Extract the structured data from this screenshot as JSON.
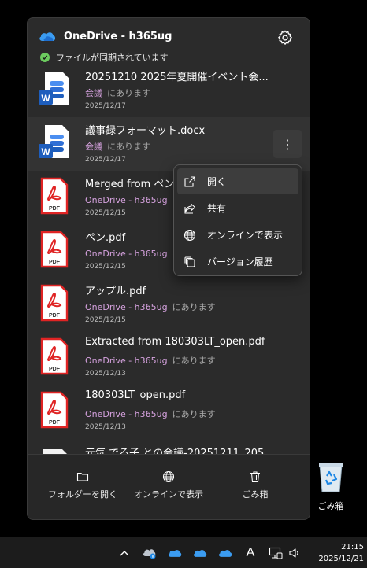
{
  "flyout": {
    "title": "OneDrive - h365ug",
    "sync_status": "ファイルが同期されています",
    "icons": {
      "logo": "onedrive-cloud-icon",
      "settings": "gear-icon"
    }
  },
  "files": [
    {
      "name": "20251210 2025年夏開催イベント会...",
      "location": "会議",
      "status": "にあります",
      "date": "2025/12/17",
      "type": "word"
    },
    {
      "name": "議事録フォーマット.docx",
      "location": "会議",
      "status": "にあります",
      "date": "2025/12/17",
      "type": "word",
      "selected": true
    },
    {
      "name": "Merged from ペン.p",
      "location": "OneDrive - h365ug",
      "status": "に",
      "date": "2025/12/15",
      "type": "pdf"
    },
    {
      "name": "ペン.pdf",
      "location": "OneDrive - h365ug",
      "status": "に",
      "date": "2025/12/15",
      "type": "pdf"
    },
    {
      "name": "アップル.pdf",
      "location": "OneDrive - h365ug",
      "status": "にあります",
      "date": "2025/12/15",
      "type": "pdf"
    },
    {
      "name": "Extracted from 180303LT_open.pdf",
      "location": "OneDrive - h365ug",
      "status": "にあります",
      "date": "2025/12/13",
      "type": "pdf"
    },
    {
      "name": "180303LT_open.pdf",
      "location": "OneDrive - h365ug",
      "status": "にあります",
      "date": "2025/12/13",
      "type": "pdf"
    },
    {
      "name": "元気 でる子 との会議-20251211_205...",
      "location": "",
      "status": "",
      "date": "",
      "type": "doc"
    }
  ],
  "pdf_label": "PDF",
  "word_label": "W",
  "more_label": "⋮",
  "context_menu": [
    {
      "label": "開く",
      "icon": "open-external-icon"
    },
    {
      "label": "共有",
      "icon": "share-icon"
    },
    {
      "label": "オンラインで表示",
      "icon": "globe-icon"
    },
    {
      "label": "バージョン履歴",
      "icon": "version-history-icon"
    }
  ],
  "bottom_bar": {
    "open_folder": "フォルダーを開く",
    "view_online": "オンラインで表示",
    "recycle_bin": "ごみ箱"
  },
  "desktop": {
    "recycle_bin_label": "ごみ箱"
  },
  "taskbar": {
    "time": "21:15",
    "date": "2025/12/21",
    "ime_label": "A"
  },
  "colors": {
    "onedrive_blue": "#3b9cf1",
    "pdf_red": "#e02424",
    "word_blue": "#1e5ebd",
    "location_purple": "#d7a3e0",
    "sync_green": "#6ccb5f"
  }
}
